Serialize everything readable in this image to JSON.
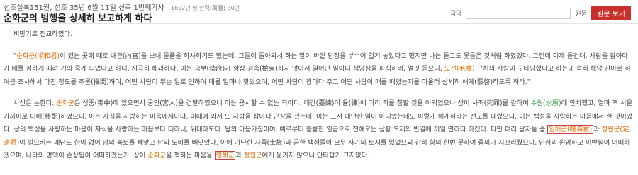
{
  "header": {
    "meta": "선조실록151권, 선조 35년 6월 11일 신축 1번째기사",
    "meta_small": "1602년 명 만력(萬曆) 30년",
    "title": "순화군의 범행을 상세히 보고하게 하다"
  },
  "toolbar": {
    "country_label": "국역",
    "search_value": "",
    "original_label": "원문",
    "view_original_button": "원문 보기"
  },
  "body": {
    "p1": "비망기로 전교하였다.",
    "p2": {
      "t0": "\"",
      "l1": "순화군(順和君)",
      "t1": "이 있는 곳에 때로 내관(內官)을 보내 물품을 하사하기도 했는데, 그들이 돌아와서 하는 말이 바깥 담장을 부수어 헐겨 놓았다고 했지만 나는 듣고도 못들은 것처럼 하였었다. 그런데 이제 듣건대, 사람을 잡아다가 매를 심하게 때려 거의 죽게 되었다고 하니, 지극히 해괴하다. 이는 금부(禁府)가 항상 검속(檢束)하지 않아서 일어난 일이니 색낭청을 파직하라. 얼핏 듣으니,",
      "l2": "모전(毛廛)",
      "t2": "근처의 사람이 구타당했다고 하는데 속히 해당 관아로 하여금 조사해서 다친 정도를 추문(推問)하여, 어떤 사람이 무슨 일로 인하여 매를 얼마나 맞았으며, 어떤 사람이 잡아다 주고 어떤 사람이 매를 때렸는지를 아울러 상세히 해계(覈啓)하도록 하라.\""
    },
    "p3": {
      "t0": "사신은 논한다.",
      "l1": "순화군",
      "t1": "은 상중(喪中)에 있으면서 궁인(宮人)을 겁탈하였으니 이는 용서할 수 없는 죄이다. 대간(臺諫)이 율(律)에 따라 죄를 청할 것을 아뢰었으나 상이 사죄(死罪)를 감하여",
      "l2": "수원(水原)",
      "t2": "에 안치했고, 얼마 후 서울 가까이로 이배(移配)하였으니, 이는 자식을 사랑하는 마음에서이다. 이때에 와서 또 사람을 잡아다 곤장을 쳤는데, 이는 그저 대단한 일이 아니었는데도 이렇게 해계하라는 전교를 내렸으니, 이는 백성을 사랑하는 마음에서 한 것이었다. 상의 백성을 사랑하는 마음이 자식을 사랑하는 마음보다 더하니, 위대하도다. 왕의 마음가짐이여, 예로부터 훌륭한 임금으로 전해오는 상황 오제의 반열에 끼일 만하다 하겠다. 다만 여러 왕자들 중",
      "l3": "임해군(臨海君)",
      "t3": "과",
      "l4": "정원군(定遠君)",
      "t4": "이 일으키는 폐단도 한이 없어 남의 농토를 빼앗고 남의 노비를 빼앗았다. 이에 가난한 사족(士族)과 궁한 백성들이 모두 자기의 토지를 잃었으되 감히 항의 한번 못하여 중외가 시끄러웠으니, 인심의 원망하고 이반됨이 어떠하겠으며, 나라의 명맥이 손상됨이 어떠하겠는가. 상이",
      "l5": "순화군",
      "t5": "을 책하는 마음을",
      "l6": "임해군",
      "t6": "과",
      "l7": "정원군",
      "t7": "에게 옮기지 않으니 안타깝기 그지없다."
    }
  }
}
